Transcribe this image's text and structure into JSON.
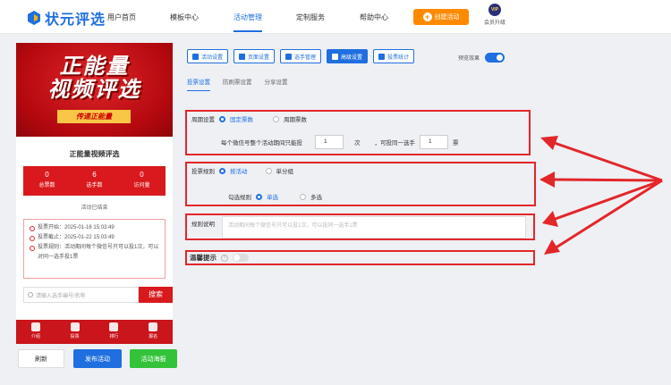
{
  "header": {
    "logo": "状元评选",
    "nav": [
      "用户首页",
      "模板中心",
      "活动管理",
      "定制服务",
      "帮助中心"
    ],
    "active_nav": 2,
    "create_button": "创建活动",
    "vip_label": "会员升级",
    "vip_badge": "VIP"
  },
  "preview_panel": {
    "banner_title_line1": "正能量",
    "banner_title_line2": "视频评选",
    "banner_ribbon": "传递正能量",
    "event_title": "正能量视频评选",
    "stats": [
      {
        "value": "0",
        "label": "总票数"
      },
      {
        "value": "6",
        "label": "选手数"
      },
      {
        "value": "0",
        "label": "访问量"
      }
    ],
    "status": "活动已结束",
    "info": [
      "投票开始：2025-01-16 15:03:49",
      "投票截止：2025-01-22 15:03:49",
      "投票规则：活动期间每个微信号只可以投1次，可以对同一选手投1票"
    ],
    "search_placeholder": "请输入选手编号/名称",
    "search_button": "搜索",
    "tabs": [
      "介绍",
      "投票",
      "排行",
      "报名"
    ]
  },
  "bottom_buttons": {
    "refresh": "刷新",
    "publish": "发布活动",
    "preview": "活动海报"
  },
  "toolbar": {
    "buttons": [
      "活动设置",
      "页面设置",
      "选手管理",
      "高级设置",
      "投票统计"
    ],
    "active": 3,
    "preview_label": "预览效果"
  },
  "subtabs": {
    "items": [
      "投票设置",
      "防刷票设置",
      "分享设置"
    ],
    "active": 0
  },
  "period": {
    "label": "周期设置",
    "option1": "固定票数",
    "option2": "周期票数",
    "line_prefix": "每个微信号整个活动期间只能投",
    "votes": "1",
    "unit1": "次",
    "mid": "，可投同一选手",
    "same": "1",
    "unit2": "票"
  },
  "rule": {
    "label": "投票规则",
    "option1": "按活动",
    "option2": "单分组",
    "select_label": "勾选规则",
    "single": "单选",
    "multi": "多选"
  },
  "desc": {
    "label": "规则说明",
    "placeholder": "活动期间每个微信号只可以投1次，可以投同一选手1票"
  },
  "tip": {
    "label": "温馨提示",
    "help": "?"
  },
  "colors": {
    "primary": "#1f6fe0",
    "highlight": "#e3262a",
    "orange": "#ff8a00",
    "green": "#34c23b"
  }
}
